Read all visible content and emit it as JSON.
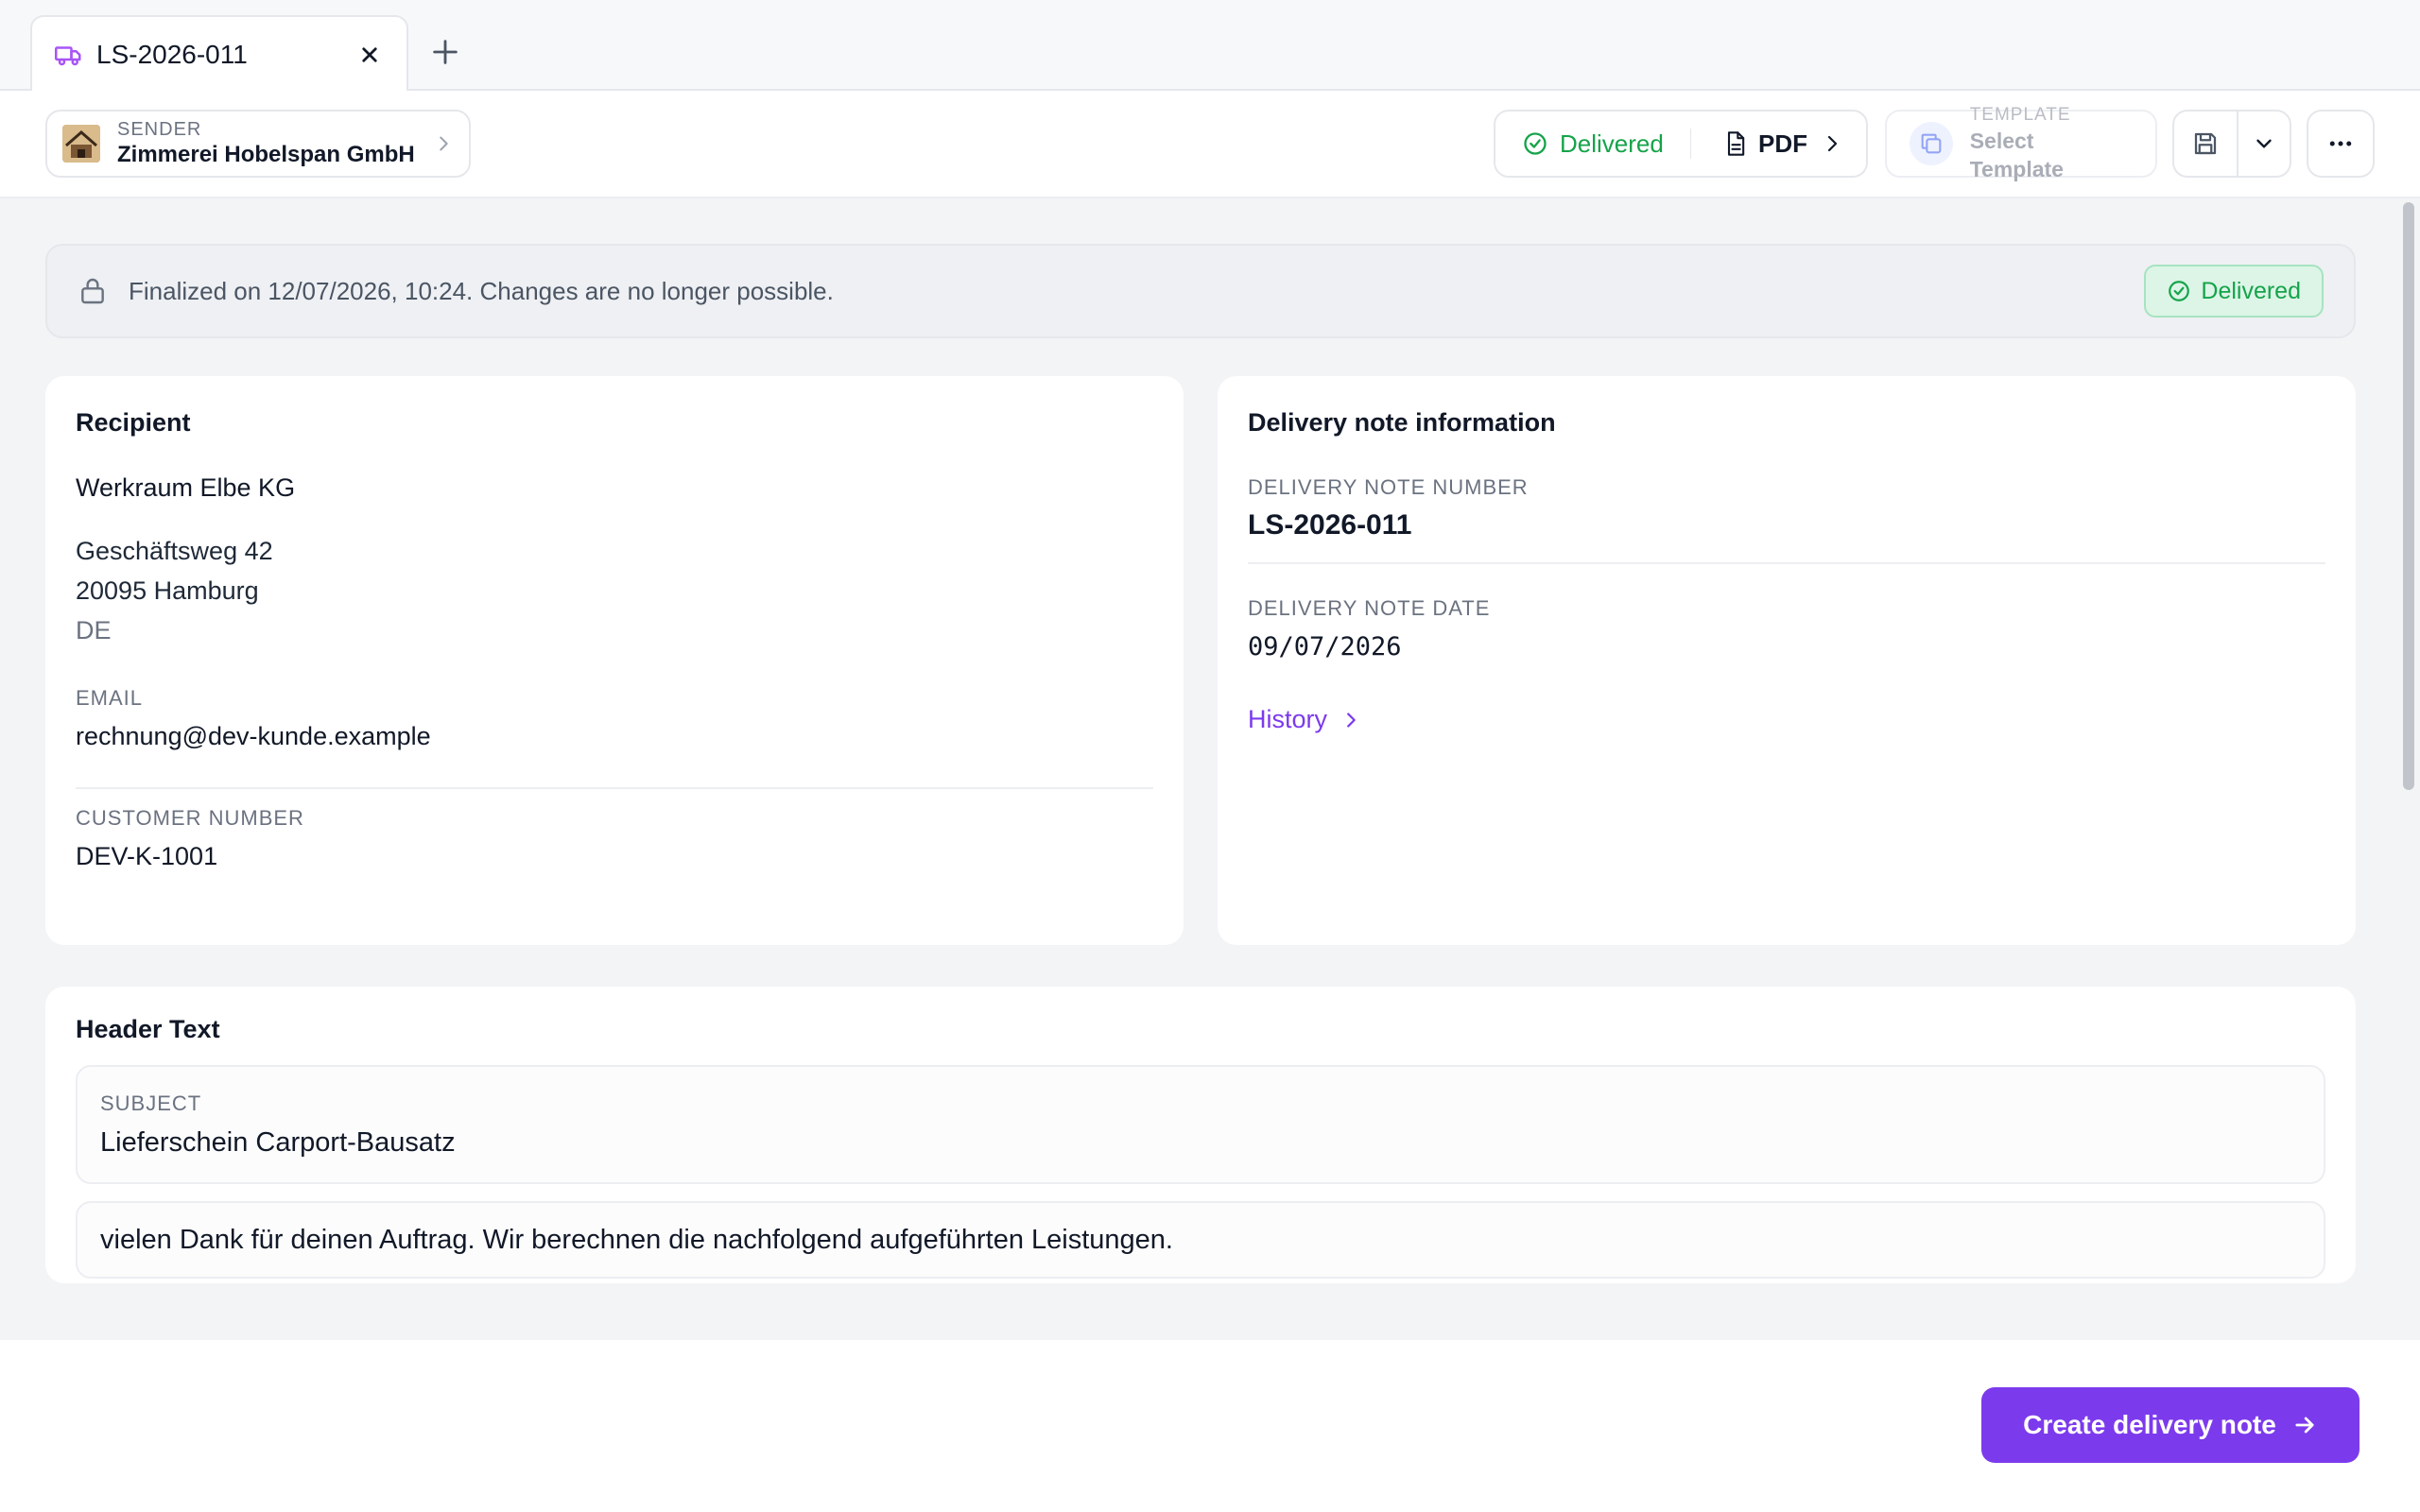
{
  "tab": {
    "title": "LS-2026-011",
    "icon": "truck-icon"
  },
  "sender": {
    "label": "SENDER",
    "name": "Zimmerei Hobelspan GmbH"
  },
  "toolbar": {
    "status_label": "Delivered",
    "pdf_label": "PDF",
    "template_label": "TEMPLATE",
    "template_value": "Select Template"
  },
  "notice": {
    "text": "Finalized on 12/07/2026, 10:24. Changes are no longer possible.",
    "badge": "Delivered"
  },
  "recipient": {
    "title": "Recipient",
    "name": "Werkraum Elbe KG",
    "street": "Geschäftsweg 42",
    "city": "20095 Hamburg",
    "country": "DE",
    "email_label": "EMAIL",
    "email": "rechnung@dev-kunde.example",
    "customer_number_label": "CUSTOMER NUMBER",
    "customer_number": "DEV-K-1001"
  },
  "info": {
    "title": "Delivery note information",
    "number_label": "DELIVERY NOTE NUMBER",
    "number": "LS-2026-011",
    "date_label": "DELIVERY NOTE DATE",
    "date": "09/07/2026",
    "history_label": "History"
  },
  "header_text": {
    "title": "Header Text",
    "subject_label": "SUBJECT",
    "subject": "Lieferschein Carport-Bausatz",
    "body": "vielen Dank für deinen Auftrag. Wir berechnen die nachfolgend aufgeführten Leistungen."
  },
  "footer": {
    "primary_label": "Create delivery note"
  },
  "colors": {
    "accent": "#7c3aed",
    "success": "#16a34a",
    "success_bg": "#dcf5e7",
    "background": "#f3f4f6"
  }
}
